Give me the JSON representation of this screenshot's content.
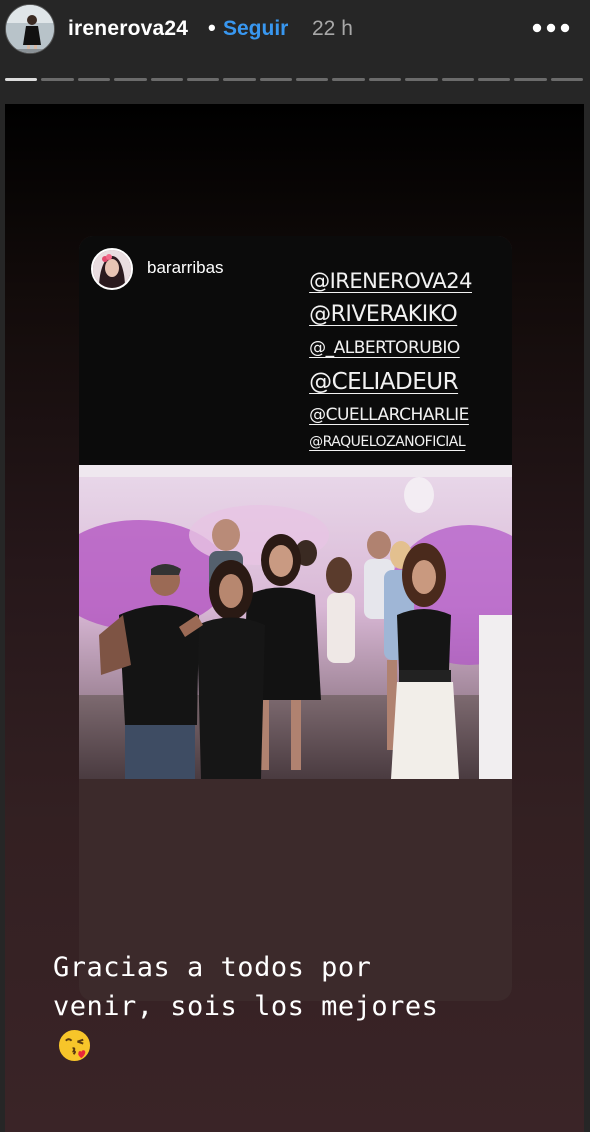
{
  "header": {
    "username": "irenerova24",
    "separator": "•",
    "follow_label": "Seguir",
    "time": "22 h"
  },
  "progress": {
    "total_segments": 16,
    "active_index": 0
  },
  "repost": {
    "username": "bararribas",
    "mentions": [
      "@IRENEROVA24",
      "@RIVERAKIKO",
      "@_ALBERTORUBIO",
      "@CELIADEUR",
      "@CUELLARCHARLIE",
      "@RAQUELOZANOFICIAL"
    ]
  },
  "caption": {
    "line1": "Gracias a todos por",
    "line2": "venir, sois los mejores"
  },
  "icons": {
    "more": "more-horizontal-icon",
    "emoji": "face-blowing-kiss-icon"
  },
  "colors": {
    "accent": "#3897f0",
    "background": "#262626"
  }
}
